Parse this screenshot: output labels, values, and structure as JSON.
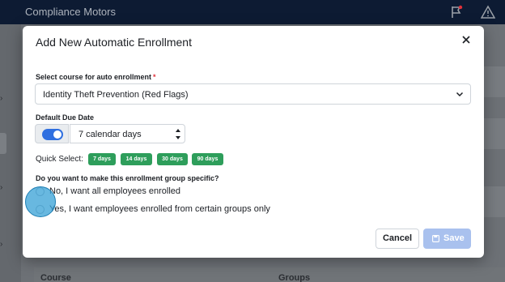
{
  "app": {
    "brand": "Compliance Motors"
  },
  "background": {
    "table_headers": [
      "Course",
      "Groups"
    ]
  },
  "modal": {
    "title": "Add New Automatic Enrollment",
    "course_label": "Select course for auto enrollment",
    "required_mark": "*",
    "course_value": "Identity Theft Prevention (Red Flags)",
    "due_date_label": "Default Due Date",
    "due_date_enabled": true,
    "due_date_value": "7 calendar days",
    "quick_select_label": "Quick Select:",
    "quick_chips": [
      "7 days",
      "14 days",
      "30 days",
      "90 days"
    ],
    "group_question": "Do you want to make this enrollment group specific?",
    "options": [
      "No, I want all employees enrolled",
      "Yes, I want employees enrolled from certain groups only"
    ],
    "cancel_label": "Cancel",
    "save_label": "Save",
    "save_disabled": true
  },
  "colors": {
    "accent": "#2f6fe0",
    "chip": "#2e9e5b",
    "save_disabled": "#a9c1ee",
    "required": "#e0313a"
  }
}
